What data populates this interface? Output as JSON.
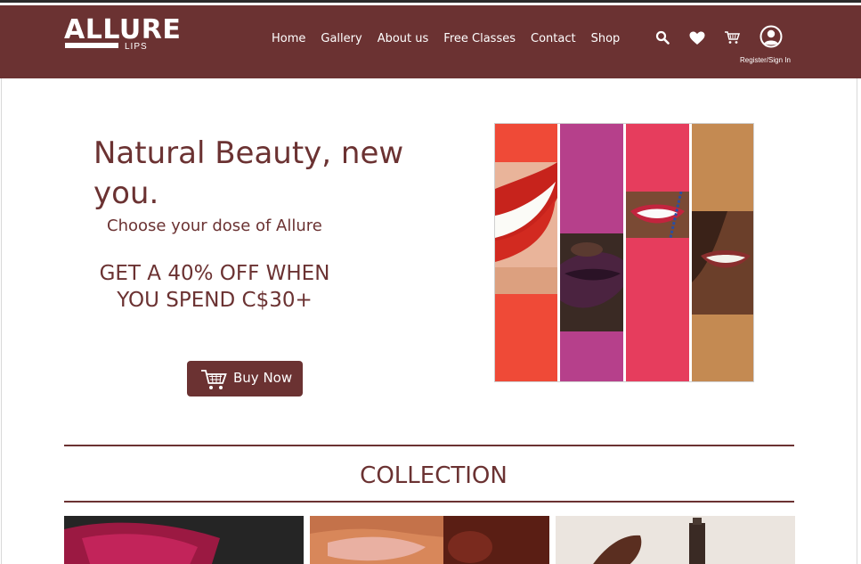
{
  "brand": {
    "logo_word": "ALLURE",
    "logo_sub": "LIPS"
  },
  "nav": {
    "items": [
      "Home",
      "Gallery",
      "About us",
      "Free Classes",
      "Contact",
      "Shop"
    ]
  },
  "header_actions": {
    "register_label": "Register/Sign In",
    "icons": [
      "search-icon",
      "heart-icon",
      "cart-icon",
      "user-icon"
    ]
  },
  "hero": {
    "title": "Natural Beauty, new you.",
    "subtitle": "Choose your dose of Allure",
    "promo": "GET A 40% OFF WHEN YOU SPEND C$30+",
    "button_label": "Buy Now"
  },
  "collection": {
    "title": "COLLECTION"
  },
  "colors": {
    "brand": "#6b3232",
    "strip_red": "#ef4a37",
    "strip_magenta": "#b6408b",
    "strip_pink": "#e63d5d",
    "strip_tan": "#c48a52"
  }
}
